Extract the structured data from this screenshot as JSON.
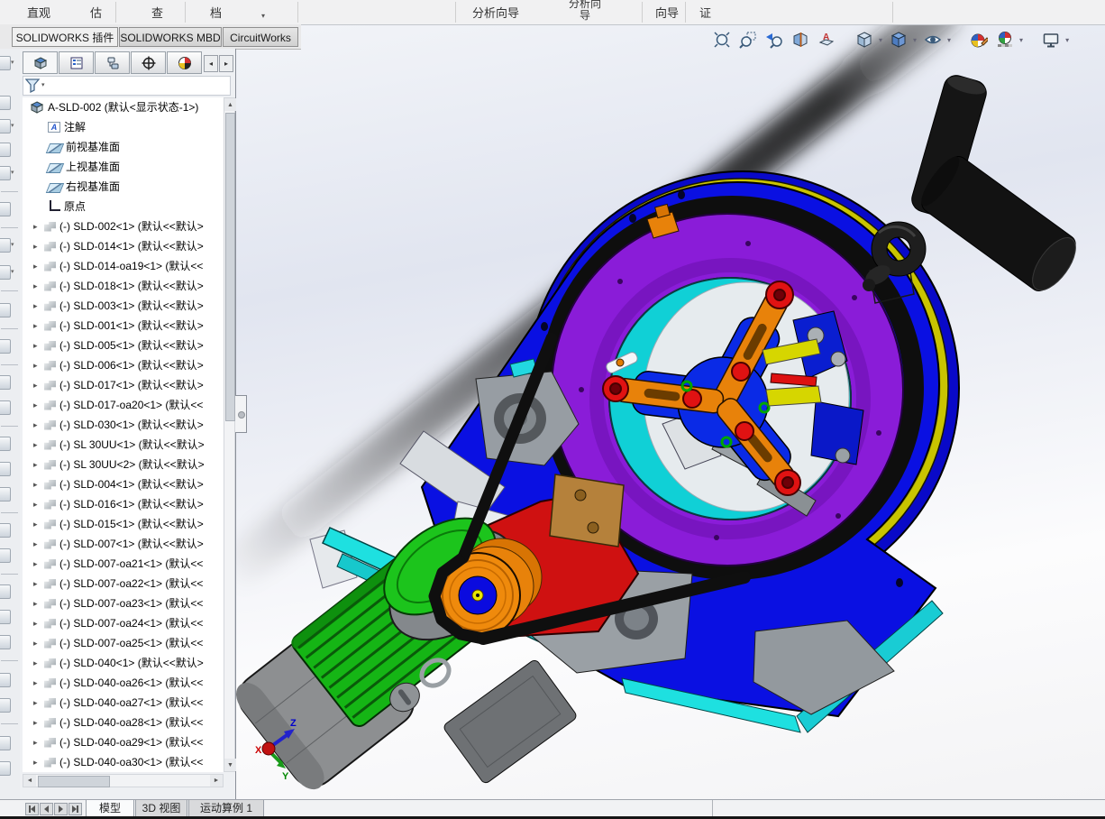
{
  "ribbon": {
    "fragments": {
      "f1": "直观",
      "f2": "估",
      "f3": "查",
      "f4": "档",
      "f5": "分析向导",
      "f6": "分析向",
      "f7": "导",
      "f8": "向导",
      "f9": "证"
    }
  },
  "command_tabs": {
    "items": [
      "SOLIDWORKS 插件",
      "SOLIDWORKS MBD",
      "CircuitWorks"
    ],
    "active": "SOLIDWORKS 插件"
  },
  "feature_panel": {
    "root": "A-SLD-002  (默认<显示状态-1>)",
    "special_items": [
      "注解",
      "前视基准面",
      "上视基准面",
      "右视基准面",
      "原点"
    ],
    "components": [
      "(-) SLD-002<1> (默认<<默认>",
      "(-) SLD-014<1> (默认<<默认>",
      "(-) SLD-014-oa19<1> (默认<<",
      "(-) SLD-018<1> (默认<<默认>",
      "(-) SLD-003<1> (默认<<默认>",
      "(-) SLD-001<1> (默认<<默认>",
      "(-) SLD-005<1> (默认<<默认>",
      "(-) SLD-006<1> (默认<<默认>",
      "(-) SLD-017<1> (默认<<默认>",
      "(-) SLD-017-oa20<1> (默认<<",
      "(-) SLD-030<1> (默认<<默认>",
      "(-) SL 30UU<1> (默认<<默认>",
      "(-) SL 30UU<2> (默认<<默认>",
      "(-) SLD-004<1> (默认<<默认>",
      "(-) SLD-016<1> (默认<<默认>",
      "(-) SLD-015<1> (默认<<默认>",
      "(-) SLD-007<1> (默认<<默认>",
      "(-) SLD-007-oa21<1> (默认<<",
      "(-) SLD-007-oa22<1> (默认<<",
      "(-) SLD-007-oa23<1> (默认<<",
      "(-) SLD-007-oa24<1> (默认<<",
      "(-) SLD-007-oa25<1> (默认<<",
      "(-) SLD-040<1> (默认<<默认>",
      "(-) SLD-040-oa26<1> (默认<<",
      "(-) SLD-040-oa27<1> (默认<<",
      "(-) SLD-040-oa28<1> (默认<<",
      "(-) SLD-040-oa29<1> (默认<<",
      "(-) SLD-040-oa30<1> (默认<<"
    ]
  },
  "viewport": {
    "hud_icons": [
      "zoom-to-fit",
      "zoom-to-area",
      "previous-view",
      "section-view",
      "annotation-view",
      "view-orientation",
      "display-style",
      "hide-show-items",
      "edit-appearance",
      "apply-scene",
      "view-settings"
    ],
    "triad": {
      "x": "X",
      "y": "Y",
      "z": "Z"
    }
  },
  "bottom_bar": {
    "tabs": [
      "模型",
      "3D 视图",
      "运动算例 1"
    ],
    "active": "模型"
  },
  "colors": {
    "housing_blue": "#0a10e2",
    "ring_purple": "#8a1cd8",
    "belt_black": "#0e0e0e",
    "drum_cyan": "#10d0d6",
    "disc_yellow": "#c9c400",
    "motor_green": "#15b515",
    "bracket_red": "#cf1111",
    "pulley_orange": "#ef8a0c",
    "block_tan": "#b5813b",
    "triad_x": "#cc0000",
    "triad_y": "#008800",
    "triad_z": "#0000cc"
  }
}
